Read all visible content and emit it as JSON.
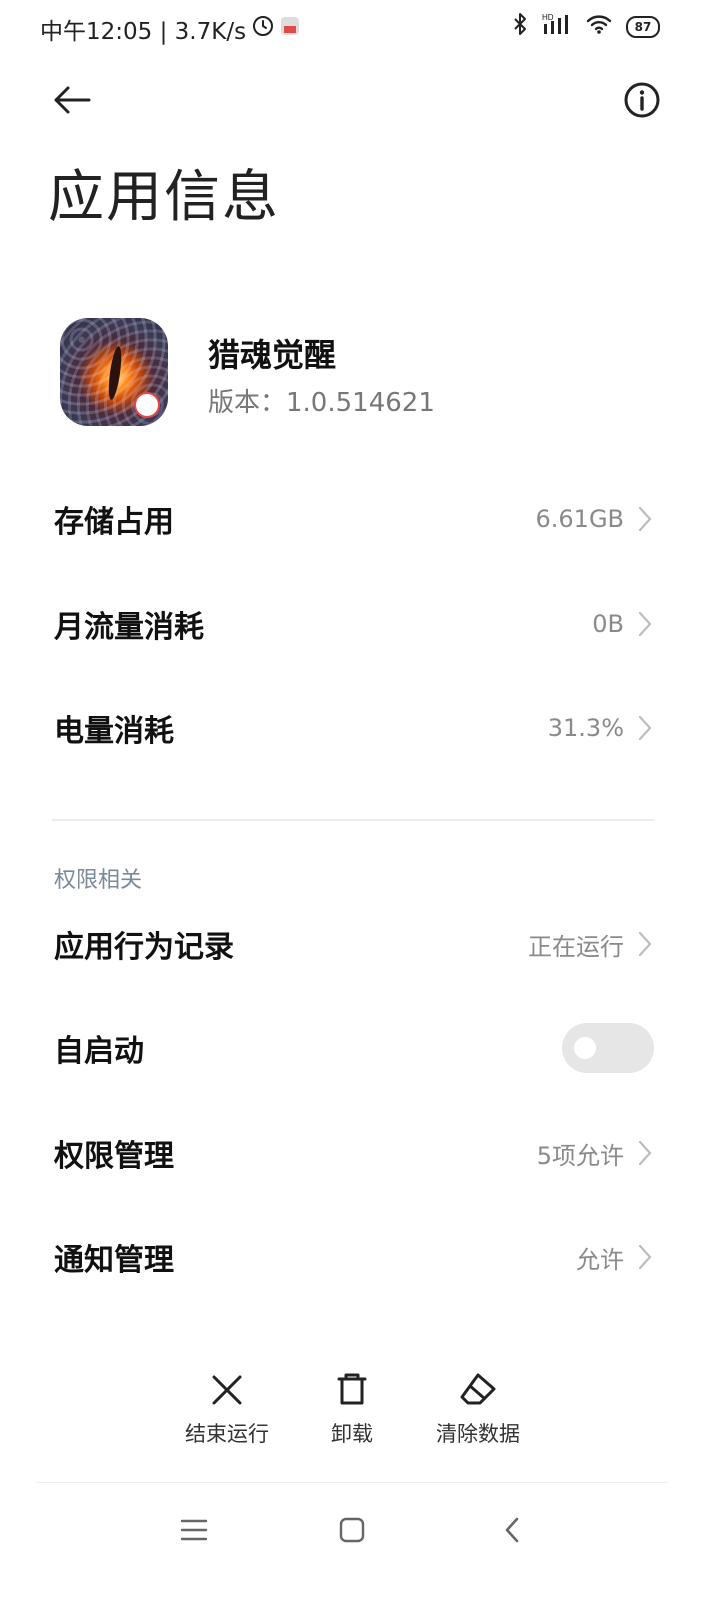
{
  "status_bar": {
    "time": "中午12:05 | 3.7K/s",
    "battery": "87",
    "network_badge": "HD"
  },
  "topbar": {
    "back_icon": "arrow-left-icon",
    "info_icon": "info-icon"
  },
  "page_title": "应用信息",
  "app": {
    "name": "猎魂觉醒",
    "version": "版本：1.0.514621"
  },
  "usage_rows": [
    {
      "label": "存储占用",
      "value": "6.61GB"
    },
    {
      "label": "月流量消耗",
      "value": "0B"
    },
    {
      "label": "电量消耗",
      "value": "31.3%"
    }
  ],
  "permissions": {
    "section_title": "权限相关",
    "behavior_record": {
      "label": "应用行为记录",
      "value": "正在运行"
    },
    "autostart": {
      "label": "自启动",
      "enabled": false
    },
    "permission_mgmt": {
      "label": "权限管理",
      "value": "5项允许"
    },
    "notification_mgmt": {
      "label": "通知管理",
      "value": "允许"
    }
  },
  "actions": [
    {
      "label": "结束运行",
      "icon": "close-icon"
    },
    {
      "label": "卸载",
      "icon": "trash-icon"
    },
    {
      "label": "清除数据",
      "icon": "eraser-icon"
    }
  ],
  "colors": {
    "section_header": "#7a8a99",
    "value_text": "#8a8a8a",
    "toggle_off": "#e6e6e6"
  }
}
